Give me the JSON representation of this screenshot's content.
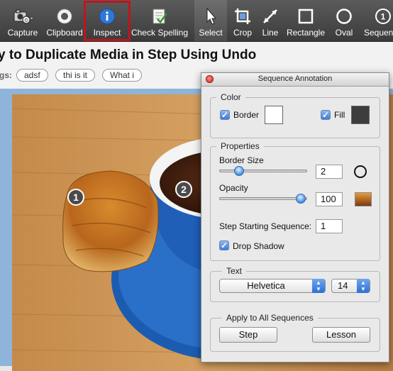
{
  "toolbar": {
    "capture": "Capture",
    "clipboard": "Clipboard",
    "inspect": "Inspect",
    "check_spelling": "Check Spelling",
    "select": "Select",
    "crop": "Crop",
    "line": "Line",
    "rectangle": "Rectangle",
    "oval": "Oval",
    "sequence": "Sequence"
  },
  "step": {
    "title": "y to Duplicate Media in Step Using Undo",
    "tags_label": "gs:",
    "tags": [
      "adsf",
      "thi is it",
      "What i"
    ]
  },
  "markers": [
    "1",
    "2"
  ],
  "panel": {
    "title": "Sequence Annotation",
    "color": {
      "label": "Color",
      "border_label": "Border",
      "border_checked": true,
      "border_color": "#ffffff",
      "fill_label": "Fill",
      "fill_checked": true,
      "fill_color": "#3d3d3d"
    },
    "properties": {
      "label": "Properties",
      "border_size_label": "Border Size",
      "border_size_value": "2",
      "border_size_level": 0.2,
      "opacity_label": "Opacity",
      "opacity_value": "100",
      "opacity_level": 1.0,
      "step_start_label": "Step Starting Sequence:",
      "step_start_value": "1",
      "drop_shadow_label": "Drop Shadow",
      "drop_shadow_checked": true
    },
    "text": {
      "label": "Text",
      "font": "Helvetica",
      "size": "14"
    },
    "apply": {
      "label": "Apply to All Sequences",
      "step_button": "Step",
      "lesson_button": "Lesson"
    }
  },
  "colors": {
    "toolbar_bg": "#4a4a4a",
    "highlight": "#c0141c",
    "canvas_bg": "#8fb4d9",
    "accent": "#3b7ddd"
  }
}
